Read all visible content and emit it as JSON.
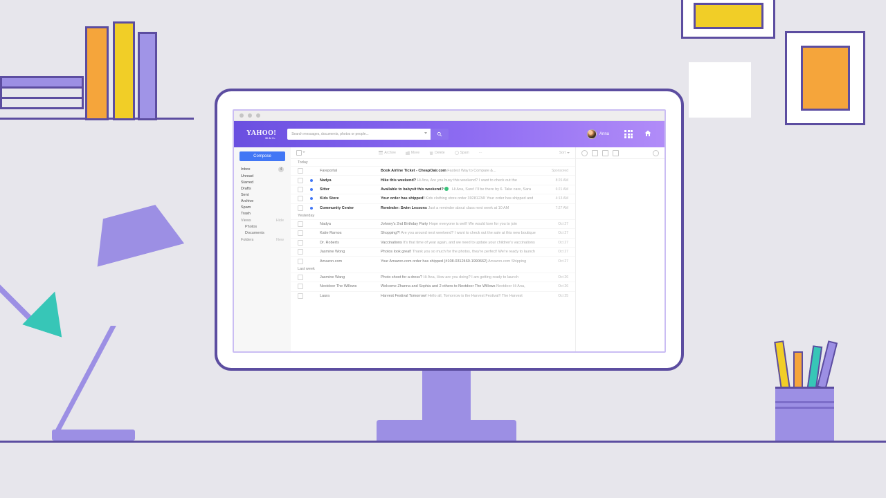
{
  "header": {
    "brand": "YAHOO!",
    "brand_sub": "MAIL",
    "search_placeholder": "Search messages, documents, photos or people...",
    "user_name": "Anna"
  },
  "sidebar": {
    "compose": "Compose",
    "nav": [
      {
        "label": "Inbox",
        "badge": "4"
      },
      {
        "label": "Unread"
      },
      {
        "label": "Starred"
      },
      {
        "label": "Drafts"
      },
      {
        "label": "Sent"
      },
      {
        "label": "Archive"
      },
      {
        "label": "Spam"
      },
      {
        "label": "Trash"
      }
    ],
    "views_head": "Views",
    "views_hide": "Hide",
    "views": [
      {
        "label": "Photos"
      },
      {
        "label": "Documents"
      }
    ],
    "folders_head": "Folders",
    "folders_new": "New"
  },
  "toolbar": {
    "archive": "Archive",
    "move": "Move",
    "delete": "Delete",
    "spam": "Spam",
    "more": "···",
    "sort": "Sort"
  },
  "groups": [
    {
      "label": "Today",
      "rows": [
        {
          "ind": "",
          "from": "Fareportal",
          "subj": "Book Airline Ticket - CheapOair.com",
          "prev": "Fastest Way to Compare &...",
          "time": "Sponsored",
          "sponsored": true
        },
        {
          "ind": "#4277f5",
          "from": "Nadya",
          "subj": "Hike this weekend?",
          "prev": "Hi Ana, Are you busy this weekend? I want to check out the",
          "time": "8:26 AM",
          "unread": true
        },
        {
          "ind": "#4277f5",
          "from": "Sitter",
          "subj": "Available to babysit this weekend?",
          "prev": "Hi Ana, Sure! I'll be there by 6. Take care, Sara",
          "time": "6:21 AM",
          "unread": true,
          "verified": true
        },
        {
          "ind": "#4277f5",
          "from": "Kids Store",
          "subj": "Your order has shipped!",
          "prev": "Kids clothing store order 39281234! Your order has shipped and",
          "time": "4:13 AM",
          "unread": true
        },
        {
          "ind": "#4277f5",
          "from": "Community Center",
          "subj": "Reminder: Swim Lessons",
          "prev": "Just a reminder about class next week at 10 AM",
          "time": "7:27 AM",
          "unread": true
        }
      ]
    },
    {
      "label": "Yesterday",
      "rows": [
        {
          "from": "Nadya",
          "subj": "Johnny's 2nd Birthday Party",
          "prev": "Hope everyone is well! We would love for you to join",
          "time": "Oct 27",
          "read": true
        },
        {
          "from": "Katie Ramos",
          "subj": "Shopping?!",
          "prev": "Are you around next weekend? I want to check out the sale at this new boutique",
          "time": "Oct 27",
          "read": true
        },
        {
          "from": "Dr. Roberts",
          "subj": "Vaccinations",
          "prev": "It's that time of year again, and we need to update your children's vaccinations",
          "time": "Oct 27",
          "read": true
        },
        {
          "from": "Jasmine Wong",
          "subj": "Photos look great!",
          "prev": "Thank you so much for the photos, they're perfect! We're ready to launch",
          "time": "Oct 27",
          "read": true
        },
        {
          "from": "Amazon.com",
          "subj": "Your Amazon.com order has shipped (#108-0312460-1990662)",
          "prev": "Amazon.com Shipping",
          "time": "Oct 27",
          "read": true
        }
      ]
    },
    {
      "label": "Last week",
      "rows": [
        {
          "from": "Jasmine Wang",
          "subj": "Photo shoot for a dress?",
          "prev": "Hi Ana, How are you doing? I am getting ready to launch",
          "time": "Oct 26",
          "read": true
        },
        {
          "from": "Nextdoor The Willows",
          "subj": "Welcome Zhanna and Sophia and 2 others to Nextdoor The Willows",
          "prev": "Nextdoor Hi Ana,",
          "time": "Oct 26",
          "read": true
        },
        {
          "from": "Laura",
          "subj": "Harvest Festival Tomorrow!",
          "prev": "Hello all, Tomorrow is the Harvest Festival!! The Harvest",
          "time": "Oct 25",
          "read": true
        }
      ]
    }
  ]
}
